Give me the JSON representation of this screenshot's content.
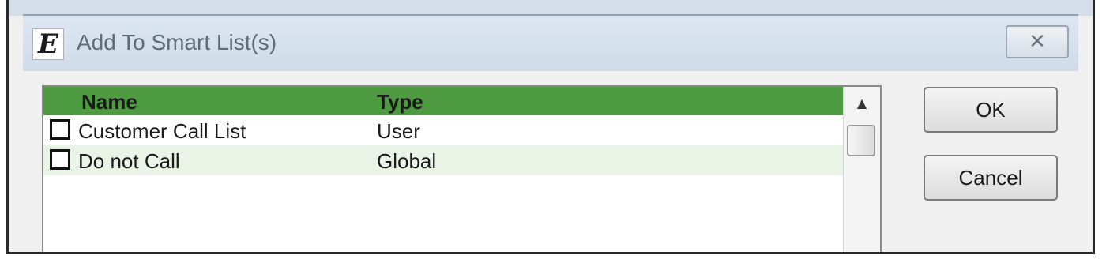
{
  "window": {
    "title": "Add To Smart List(s)",
    "icon": "E",
    "close_label": "✕"
  },
  "list": {
    "columns": [
      "Name",
      "Type"
    ],
    "header_color": "#4e9a41",
    "rows": [
      {
        "name": "Customer Call List",
        "type": "User",
        "checked": false
      },
      {
        "name": "Do not Call",
        "type": "Global",
        "checked": false
      }
    ]
  },
  "buttons": {
    "ok": "OK",
    "cancel": "Cancel"
  },
  "scrollbar": {
    "up_arrow": "▲"
  }
}
